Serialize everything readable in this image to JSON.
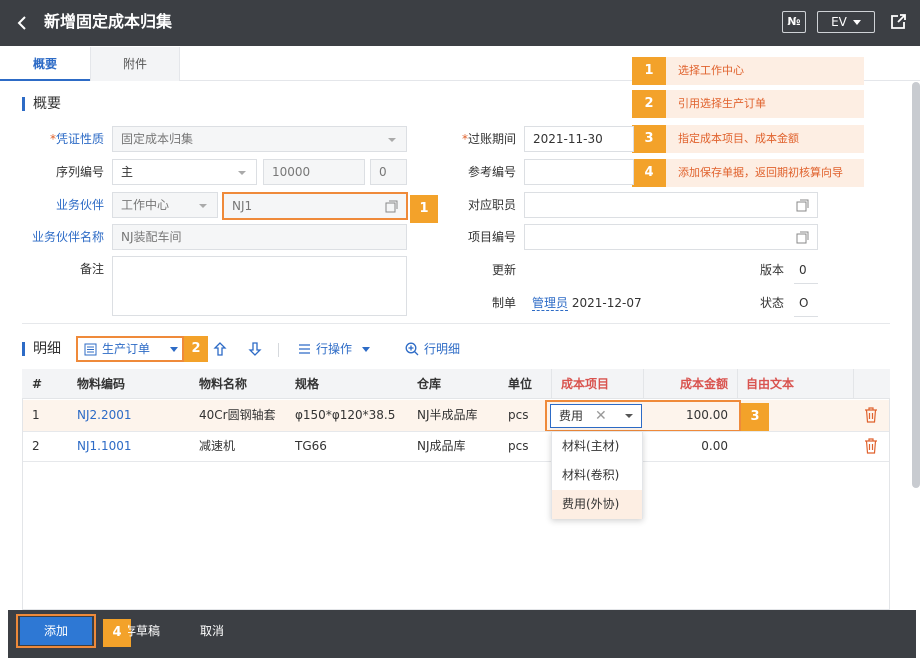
{
  "header": {
    "title": "新增固定成本归集",
    "no_label": "№",
    "ev_label": "EV"
  },
  "tabs": [
    {
      "label": "概要",
      "active": true
    },
    {
      "label": "附件",
      "active": false
    }
  ],
  "callouts": [
    {
      "num": "1",
      "text": "选择工作中心"
    },
    {
      "num": "2",
      "text": "引用选择生产订单"
    },
    {
      "num": "3",
      "text": "指定成本项目、成本金额"
    },
    {
      "num": "4",
      "text": "添加保存单据，返回期初核算向导"
    }
  ],
  "summary": {
    "section_title": "概要",
    "voucher_type": {
      "label": "凭证性质",
      "required_mark": "*",
      "value": "固定成本归集"
    },
    "serial": {
      "label": "序列编号",
      "value": "主",
      "number": "10000",
      "extra": "0"
    },
    "partner": {
      "label": "业务伙伴",
      "type": "工作中心",
      "value": "NJ1"
    },
    "partner_name": {
      "label": "业务伙伴名称",
      "value": "NJ装配车间"
    },
    "remark": {
      "label": "备注",
      "value": ""
    },
    "period": {
      "label": "过账期间",
      "required_mark": "*",
      "value": "2021-11-30"
    },
    "ref_no": {
      "label": "参考编号",
      "value": ""
    },
    "employee": {
      "label": "对应职员",
      "value": ""
    },
    "project": {
      "label": "项目编号",
      "value": ""
    },
    "updated": {
      "label": "更新",
      "value": ""
    },
    "version": {
      "label": "版本",
      "value": "0"
    },
    "creator": {
      "label": "制单",
      "user": "管理员",
      "date": "2021-12-07"
    },
    "status": {
      "label": "状态",
      "value": "O"
    }
  },
  "detail": {
    "section_title": "明细",
    "source_label": "生产订单",
    "row_ops_label": "行操作",
    "row_detail_label": "行明细",
    "columns": [
      "#",
      "物料编码",
      "物料名称",
      "规格",
      "仓库",
      "单位",
      "成本项目",
      "成本金额",
      "自由文本"
    ],
    "rows": [
      {
        "no": "1",
        "code": "NJ2.2001",
        "name": "40Cr圆钢轴套",
        "spec": "φ150*φ120*38.5",
        "warehouse": "NJ半成品库",
        "unit": "pcs",
        "cost_item": "费用",
        "amount": "100.00",
        "text": ""
      },
      {
        "no": "2",
        "code": "NJ1.1001",
        "name": "减速机",
        "spec": "TG66",
        "warehouse": "NJ成品库",
        "unit": "pcs",
        "cost_item": "",
        "amount": "0.00",
        "text": ""
      }
    ],
    "cost_item_options": [
      "材料(主材)",
      "材料(卷积)",
      "费用(外协)"
    ],
    "selected_option_index": 2
  },
  "footer": {
    "add_label": "添加",
    "draft_label": "存草稿",
    "cancel_label": "取消"
  },
  "colors": {
    "accent": "#2d6bc6",
    "callout_badge": "#f3a22a",
    "callout_bg": "#fdeee3",
    "callout_text": "#e0622d",
    "highlight_border": "#ef8a3a",
    "header_bg": "#3c3f44",
    "danger": "#d9534f"
  }
}
